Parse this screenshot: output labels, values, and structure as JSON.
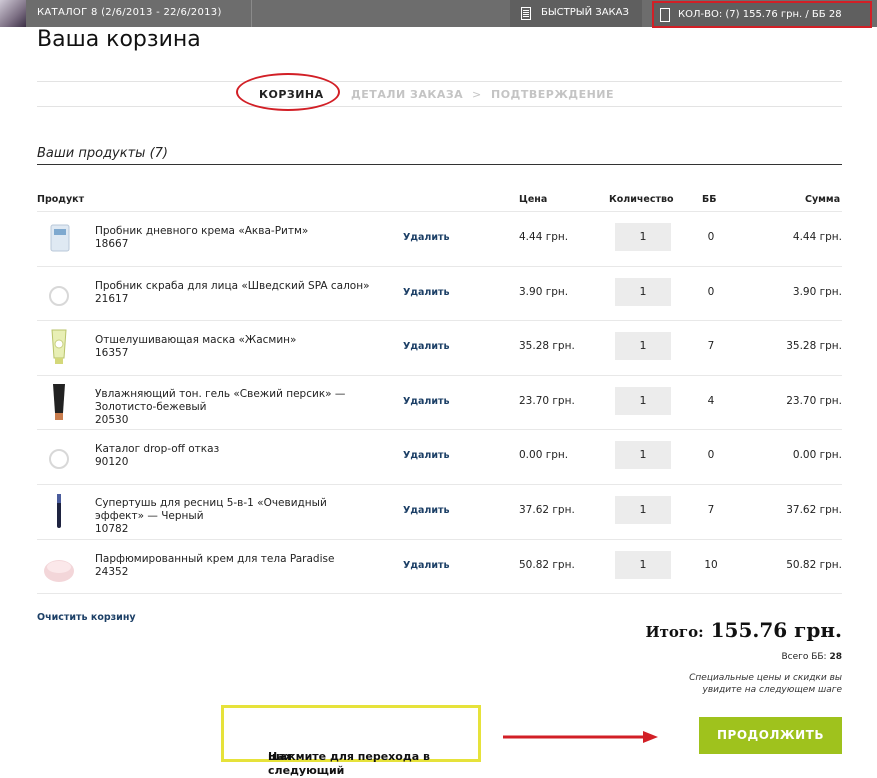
{
  "topbar": {
    "catalog": "КАТАЛОГ 8  (2/6/2013 - 22/6/2013)",
    "quick_order": "БЫСТРЫЙ ЗАКАЗ",
    "cart_summary": "КОЛ-ВО: (7)  155.76 грн. / ББ 28"
  },
  "page_title": "Ваша корзина",
  "steps": {
    "step1": "КОРЗИНА",
    "step2": "ДЕТАЛИ ЗАКАЗА",
    "arrow": ">",
    "step3": "ПОДТВЕРЖДЕНИЕ"
  },
  "products_title": "Ваши продукты (7)",
  "table": {
    "headers": {
      "product": "Продукт",
      "price": "Цена",
      "qty": "Количество",
      "bb": "ББ",
      "sum": "Сумма"
    },
    "rows": [
      {
        "name1": "Пробник дневного крема «Аква-Ритм»",
        "name2": "18667",
        "name3": "",
        "delete": "Удалить",
        "price": "4.44 грн.",
        "qty": "1",
        "bb": "0",
        "sum": "4.44 грн.",
        "img": "sachet-icon"
      },
      {
        "name1": "Пробник скраба для лица «Шведский SPA салон»",
        "name2": "21617",
        "name3": "",
        "delete": "Удалить",
        "price": "3.90 грн.",
        "qty": "1",
        "bb": "0",
        "sum": "3.90 грн.",
        "img": "placeholder-circle-icon"
      },
      {
        "name1": "Отшелушивающая маска «Жасмин»",
        "name2": "16357",
        "name3": "",
        "delete": "Удалить",
        "price": "35.28 грн.",
        "qty": "1",
        "bb": "7",
        "sum": "35.28 грн.",
        "img": "tube-icon"
      },
      {
        "name1": "Увлажняющий тон. гель «Свежий персик» —",
        "name2": "Золотисто-бежевый",
        "name3": "20530",
        "delete": "Удалить",
        "price": "23.70 грн.",
        "qty": "1",
        "bb": "4",
        "sum": "23.70 грн.",
        "img": "dark-tube-icon"
      },
      {
        "name1": "Каталог drop-off отказ",
        "name2": "90120",
        "name3": "",
        "delete": "Удалить",
        "price": "0.00 грн.",
        "qty": "1",
        "bb": "0",
        "sum": "0.00 грн.",
        "img": "placeholder-circle-icon"
      },
      {
        "name1": "Супертушь для ресниц 5-в-1 «Очевидный",
        "name2": "эффект» — Черный",
        "name3": "10782",
        "delete": "Удалить",
        "price": "37.62 грн.",
        "qty": "1",
        "bb": "7",
        "sum": "37.62 грн.",
        "img": "mascara-icon"
      },
      {
        "name1": "Парфюмированный крем для тела Paradise",
        "name2": "24352",
        "name3": "",
        "delete": "Удалить",
        "price": "50.82 грн.",
        "qty": "1",
        "bb": "10",
        "sum": "50.82 грн.",
        "img": "cream-jar-icon"
      }
    ]
  },
  "clear_cart": "Очистить корзину",
  "total": {
    "label": "Итого:",
    "value": "155.76 грн."
  },
  "total_bb": {
    "label": "Всего ББ:",
    "value": "28"
  },
  "note": {
    "line1": "Специальные цены и скидки вы",
    "line2": "увидите на следующем шаге"
  },
  "continue_button": "ПРОДОЛЖИТЬ",
  "hint": {
    "line1": "Нажмите для перехода в следующий",
    "line2": "шаг"
  },
  "colors": {
    "accent_green": "#9fc21d",
    "annotation_red": "#d21f26",
    "annotation_yellow": "#e6e23a",
    "link_blue": "#1c3f66"
  }
}
